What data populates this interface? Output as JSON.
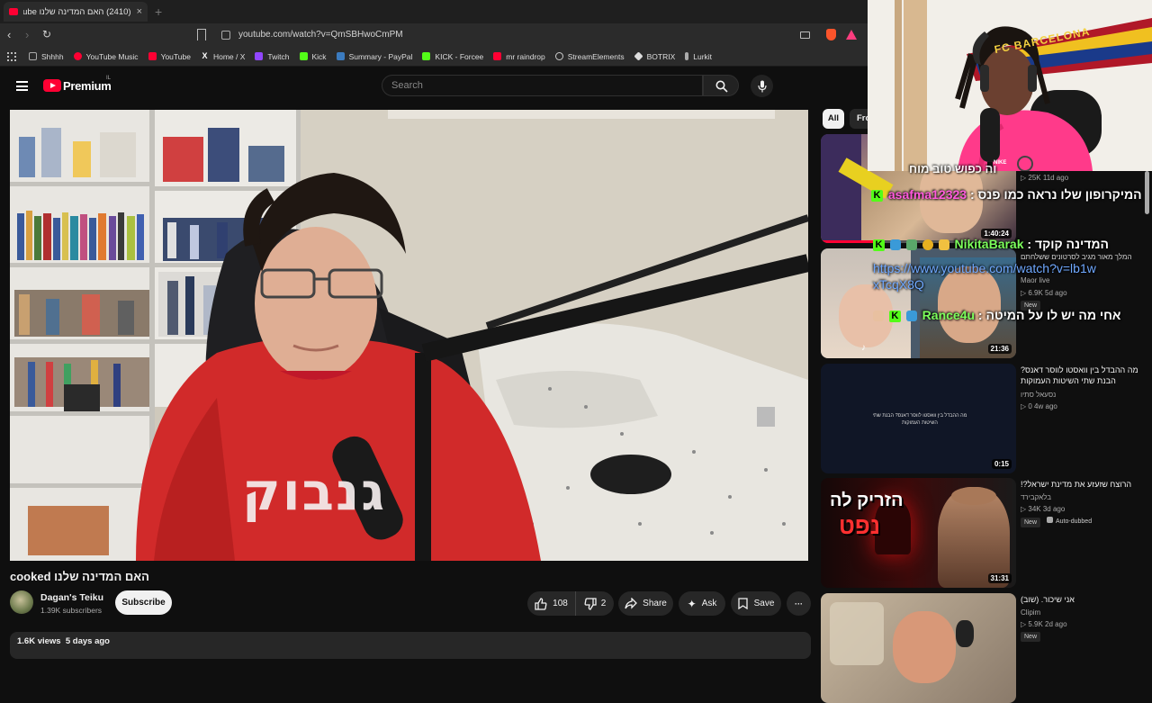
{
  "browser": {
    "tab_title": "(2410) האם המדינה שלנו cooked - YouTube",
    "tab_close": "×",
    "new_tab": "+",
    "url": "youtube.com/watch?v=QmSBHwoCmPM",
    "bookmarks": [
      {
        "label": "Shhhh",
        "color": "#888888"
      },
      {
        "label": "YouTube Music",
        "color": "#ff0033"
      },
      {
        "label": "YouTube",
        "color": "#ff0033"
      },
      {
        "label": "Home / X",
        "color": "#ffffff"
      },
      {
        "label": "Twitch",
        "color": "#9146ff"
      },
      {
        "label": "Kick",
        "color": "#53fc18"
      },
      {
        "label": "Summary - PayPal",
        "color": "#3b7bbf"
      },
      {
        "label": "KICK - Forcee",
        "color": "#53fc18"
      },
      {
        "label": "mr raindrop",
        "color": "#ff0033"
      },
      {
        "label": "StreamElements",
        "color": "#cccccc"
      },
      {
        "label": "BOTRIX",
        "color": "#dddddd"
      },
      {
        "label": "Lurkit",
        "color": "#aaaaaa"
      }
    ]
  },
  "header": {
    "logo_text": "Premium",
    "country": "IL",
    "search_placeholder": "Search"
  },
  "video": {
    "title": "האם המדינה שלנו cooked",
    "channel": "Dagan's Teiku",
    "subscribers": "1.39K subscribers",
    "subscribe_label": "Subscribe",
    "likes": "108",
    "dislikes": "2",
    "share_label": "Share",
    "ask_label": "Ask",
    "save_label": "Save",
    "more_label": "···",
    "views": "1.6K views",
    "date": "5 days ago",
    "shirt_text": "גנבוק"
  },
  "sidebar": {
    "chips": [
      "All",
      "Fro"
    ],
    "items": [
      {
        "title": "",
        "channel": "",
        "meta": "25K  11d ago",
        "duration": "1:40:24",
        "badge": ""
      },
      {
        "title": "המלך מאור מגיב לסרטונים ששלחתם",
        "channel": "Maor live",
        "meta": "6.9K  5d ago",
        "duration": "21:36",
        "badge": "New"
      },
      {
        "title": "מה ההבדל בין וואסטו לווסר דאנס? הבנת שתי השיטות העמוקות",
        "channel": "נסעאל סתיו",
        "meta": "0  4w ago",
        "duration": "0:15",
        "badge": ""
      },
      {
        "title": "הרוצח שזעזע את מדינת ישראל?!",
        "channel": "בלאקבירד",
        "meta": "34K  3d ago",
        "duration": "31:31",
        "badge": "New",
        "badge2": "Auto-dubbed"
      },
      {
        "title": "אני שיכור. (שוב)",
        "channel": "Clipim",
        "meta": "5.9K  2d ago",
        "duration": "",
        "badge": "New"
      }
    ],
    "thumb3_text": "מה ההבדל בין וואסטו לווסר דאנס? הבנת שתי השיטות העמוקות",
    "thumb4_text_line1": "הזריק לה",
    "thumb4_text_line2": "נפט"
  },
  "webcam": {
    "scarf_text": "FC BARCELONA",
    "shirt_brand": "NIKE"
  },
  "chat": [
    {
      "user": "asafma12323",
      "text": "המיקרופון שלו נראה כמו פנס",
      "user_color": "#ff5adc"
    },
    {
      "user": "NikitaBarak",
      "text": "המדינה קוקד",
      "user_color": "#7cff5c"
    },
    {
      "user": "",
      "text": "https://www.youtube.com/watch?v=lb1wxTcqX8Q",
      "user_color": "#6fa8ff"
    },
    {
      "user": "Rance4u",
      "text": "אחי מה יש לו על המיטה",
      "user_color": "#7cff5c"
    }
  ],
  "chat_top_partial": "וה כפוש טוב מוח",
  "colors": {
    "yt_red": "#ff0033",
    "kick_green": "#53fc18",
    "bg": "#0f0f0f"
  }
}
